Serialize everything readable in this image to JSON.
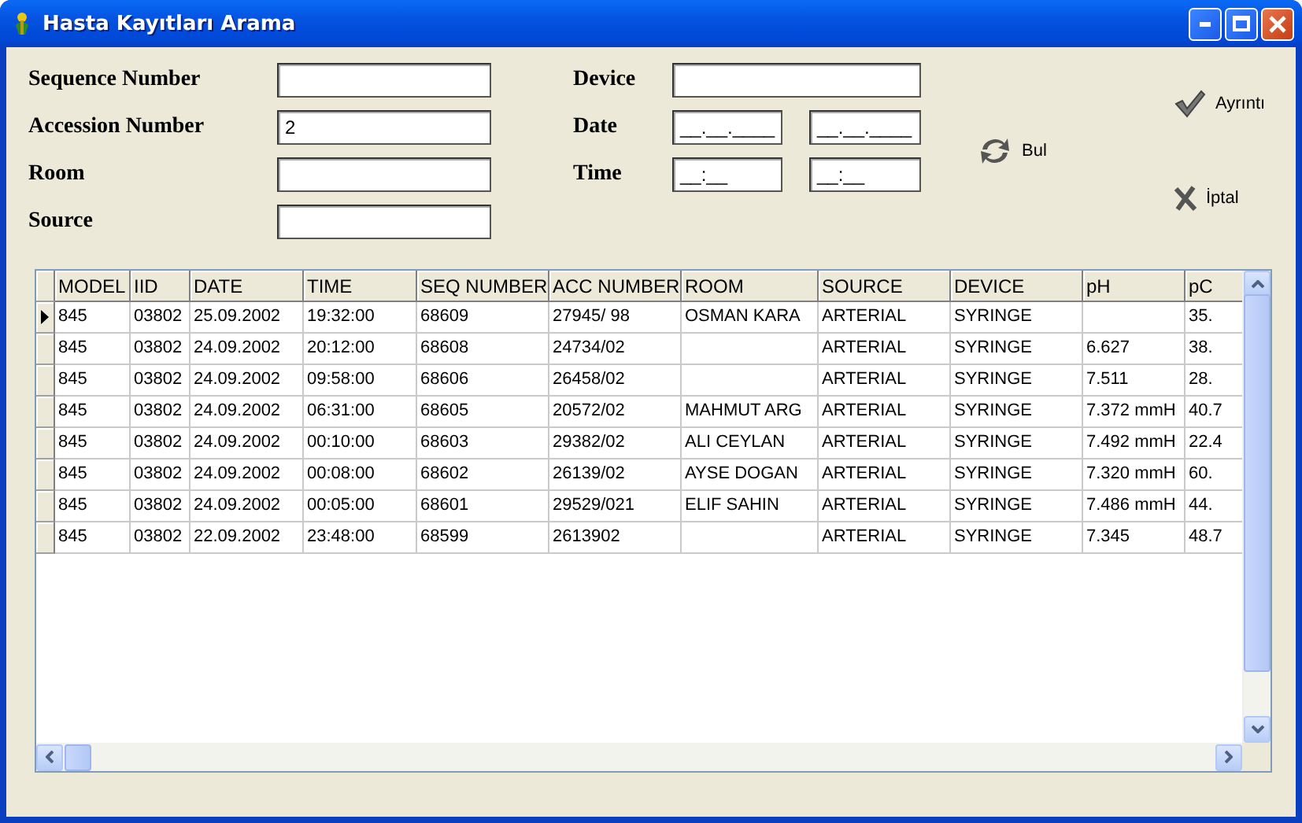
{
  "window": {
    "title": "Hasta Kayıtları Arama"
  },
  "form": {
    "left": [
      {
        "label": "Sequence Number"
      },
      {
        "label": "Accession Number",
        "value": "2"
      },
      {
        "label": "Room"
      },
      {
        "label": "Source"
      }
    ],
    "device": {
      "label": "Device"
    },
    "date": {
      "label": "Date",
      "from": "__.__.____",
      "to": "__.__.____"
    },
    "time": {
      "label": "Time",
      "from": "__:__",
      "to": "__:__"
    }
  },
  "buttons": [
    {
      "kind": "find",
      "label": "Bul"
    },
    {
      "kind": "details",
      "label": "Ayrıntı"
    },
    {
      "kind": "cancel",
      "label": "İptal"
    }
  ],
  "table": {
    "columns": [
      "MODEL",
      "IID",
      "DATE",
      "TIME",
      "SEQ NUMBER",
      "ACC NUMBER",
      "ROOM",
      "SOURCE",
      "DEVICE",
      "pH",
      "pC"
    ],
    "rows": [
      {
        "selected": true,
        "cells": [
          "845",
          "03802",
          "25.09.2002",
          "19:32:00",
          "68609",
          "27945/ 98",
          "OSMAN KARA",
          "ARTERIAL",
          "SYRINGE",
          "",
          "35."
        ]
      },
      {
        "selected": false,
        "cells": [
          "845",
          "03802",
          "24.09.2002",
          "20:12:00",
          "68608",
          "24734/02",
          "",
          "ARTERIAL",
          "SYRINGE",
          "6.627",
          "38."
        ]
      },
      {
        "selected": false,
        "cells": [
          "845",
          "03802",
          "24.09.2002",
          "09:58:00",
          "68606",
          "26458/02",
          "",
          "ARTERIAL",
          "SYRINGE",
          "7.511",
          "28."
        ]
      },
      {
        "selected": false,
        "cells": [
          "845",
          "03802",
          "24.09.2002",
          "06:31:00",
          "68605",
          "20572/02",
          "MAHMUT ARG",
          "ARTERIAL",
          "SYRINGE",
          "7.372  mmH",
          "40.7"
        ]
      },
      {
        "selected": false,
        "cells": [
          "845",
          "03802",
          "24.09.2002",
          "00:10:00",
          "68603",
          "29382/02",
          "ALI CEYLAN",
          "ARTERIAL",
          "SYRINGE",
          "7.492  mmH",
          "22.4"
        ]
      },
      {
        "selected": false,
        "cells": [
          "845",
          "03802",
          "24.09.2002",
          "00:08:00",
          "68602",
          "26139/02",
          "AYSE DOGAN",
          "ARTERIAL",
          "SYRINGE",
          "7.320  mmH",
          "60."
        ]
      },
      {
        "selected": false,
        "cells": [
          "845",
          "03802",
          "24.09.2002",
          "00:05:00",
          "68601",
          "29529/021",
          "ELIF SAHIN",
          "ARTERIAL",
          "SYRINGE",
          "7.486  mmH",
          "44."
        ]
      },
      {
        "selected": false,
        "cells": [
          "845",
          "03802",
          "22.09.2002",
          "23:48:00",
          "68599",
          "2613902",
          "",
          "ARTERIAL",
          "SYRINGE",
          "7.345",
          "48.7"
        ]
      }
    ]
  }
}
